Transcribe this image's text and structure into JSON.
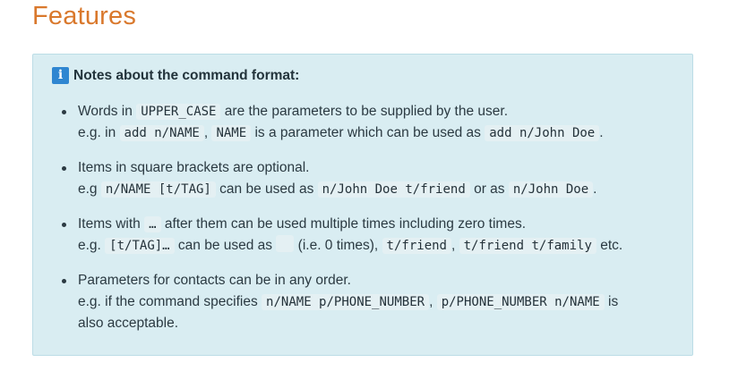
{
  "page": {
    "heading": "Features"
  },
  "note": {
    "icon": "info-icon",
    "icon_glyph": "i",
    "title": "Notes about the command format:",
    "items": [
      {
        "l1_a": "Words in ",
        "l1_code": "UPPER_CASE",
        "l1_b": " are the parameters to be supplied by the user.",
        "l2_a": "e.g. in ",
        "l2_code1": "add n/NAME",
        "l2_b": ", ",
        "l2_code2": "NAME",
        "l2_c": " is a parameter which can be used as ",
        "l2_code3": "add n/John Doe",
        "l2_d": "."
      },
      {
        "l1_a": "Items in square brackets are optional.",
        "l2_a": "e.g ",
        "l2_code1": "n/NAME [t/TAG]",
        "l2_b": " can be used as ",
        "l2_code2": "n/John Doe t/friend",
        "l2_c": " or as ",
        "l2_code3": "n/John Doe",
        "l2_d": "."
      },
      {
        "l1_a": "Items with ",
        "l1_code": "…",
        "l1_b": " after them can be used multiple times including zero times.",
        "l2_a": "e.g. ",
        "l2_code1": "[t/TAG]…",
        "l2_b": " can be used as ",
        "l2_c": " (i.e. 0 times), ",
        "l2_code2": "t/friend",
        "l2_d": ", ",
        "l2_code3": "t/friend t/family",
        "l2_e": " etc."
      },
      {
        "l1_a": "Parameters for contacts can be in any order.",
        "l2_a": "e.g. if the command specifies ",
        "l2_code1": "n/NAME p/PHONE_NUMBER",
        "l2_b": ", ",
        "l2_code2": "p/PHONE_NUMBER n/NAME",
        "l2_c": " is",
        "l3_a": "also acceptable."
      }
    ]
  }
}
